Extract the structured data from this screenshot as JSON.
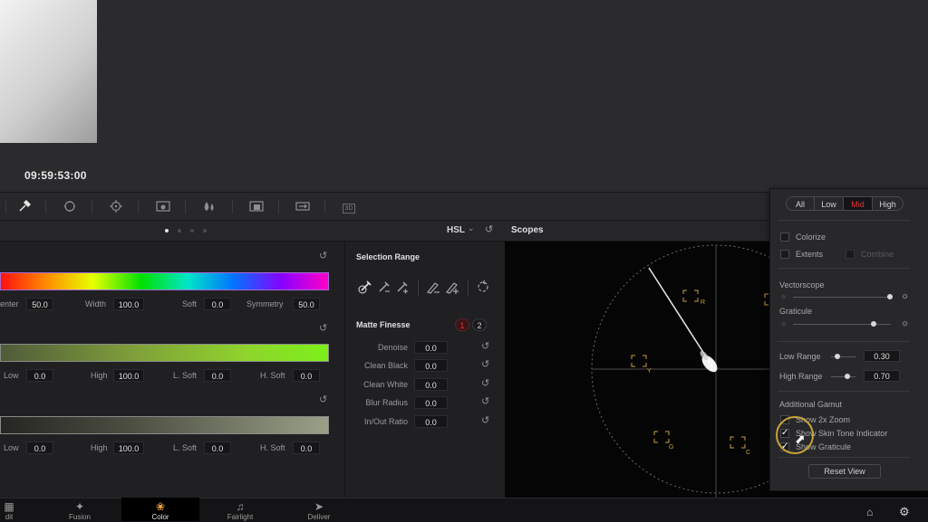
{
  "viewer": {
    "timecode": "09:59:53:00"
  },
  "toolbar": {
    "icons": [
      "qualifier-picker-icon",
      "power-window-icon",
      "tracker-icon",
      "magic-mask-icon",
      "blur-icon",
      "key-icon",
      "sizing-icon",
      "3d-icon"
    ],
    "icon_3d_label": "3D"
  },
  "qualifier": {
    "mode": "HSL",
    "hue": {
      "center_label": "enter",
      "center": "50.0",
      "width_label": "Width",
      "width": "100.0",
      "soft_label": "Soft",
      "soft": "0.0",
      "symmetry_label": "Symmetry",
      "symmetry": "50.0"
    },
    "sat": {
      "low_label": "Low",
      "low": "0.0",
      "high_label": "High",
      "high": "100.0",
      "lsoft_label": "L. Soft",
      "lsoft": "0.0",
      "hsoft_label": "H. Soft",
      "hsoft": "0.0"
    },
    "lum": {
      "low_label": "Low",
      "low": "0.0",
      "high_label": "High",
      "high": "100.0",
      "lsoft_label": "L. Soft",
      "lsoft": "0.0",
      "hsoft_label": "H. Soft",
      "hsoft": "0.0"
    }
  },
  "selection_range": {
    "title": "Selection Range",
    "matte_finesse": {
      "title": "Matte Finesse",
      "buttons": [
        "1",
        "2"
      ],
      "rows": [
        {
          "label": "Denoise",
          "value": "0.0"
        },
        {
          "label": "Clean Black",
          "value": "0.0"
        },
        {
          "label": "Clean White",
          "value": "0.0"
        },
        {
          "label": "Blur Radius",
          "value": "0.0"
        },
        {
          "label": "In/Out Ratio",
          "value": "0.0"
        }
      ]
    }
  },
  "scopes": {
    "title": "Scopes",
    "targets": [
      "R",
      "Y",
      "G",
      "C"
    ]
  },
  "scope_settings": {
    "range_tabs": [
      "All",
      "Low",
      "Mid",
      "High"
    ],
    "active_tab": "Mid",
    "colorize": "Colorize",
    "extents": "Extents",
    "combine": "Combine",
    "vectorscope": "Vectorscope",
    "graticule": "Graticule",
    "low_range_label": "Low Range",
    "low_range": "0.30",
    "high_range_label": "High Range",
    "high_range": "0.70",
    "additional_gamut": "Additional Gamut",
    "show_2x_zoom": "Show 2x Zoom",
    "show_skin_tone": "Show Skin Tone Indicator",
    "show_graticule": "Show Graticule",
    "reset_view": "Reset View",
    "accent_color": "#e0343a"
  },
  "pagebar": {
    "tabs": [
      {
        "label": "dit",
        "icon": "edit-icon"
      },
      {
        "label": "Fusion",
        "icon": "fusion-icon"
      },
      {
        "label": "Color",
        "icon": "color-icon"
      },
      {
        "label": "Fairlight",
        "icon": "fairlight-icon"
      },
      {
        "label": "Deliver",
        "icon": "deliver-icon"
      }
    ]
  }
}
